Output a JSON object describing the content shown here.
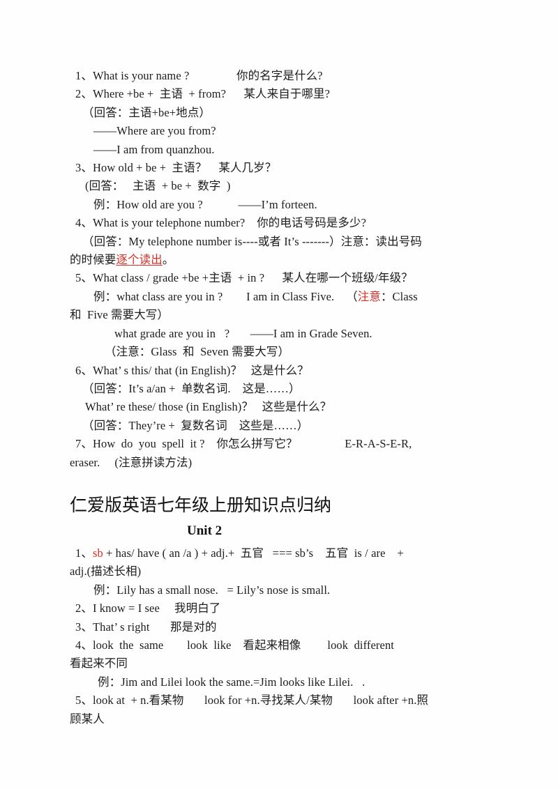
{
  "document": {
    "type": "scanned-study-notes",
    "language": "zh-CN / en",
    "text_color": "#1c1c1c",
    "accent_color": "#d93025",
    "background": "#ffffff"
  },
  "section_one": {
    "lines": [
      {
        "id": "l1",
        "indent": "ind0",
        "text": "1、What is your name ?                你的名字是什么?"
      },
      {
        "id": "l2",
        "indent": "ind0",
        "text": "2、Where +be +  主语  + from?      某人来自于哪里?"
      },
      {
        "id": "l3",
        "indent": "ind1",
        "text": "（回答：主语+be+地点）"
      },
      {
        "id": "l4",
        "indent": "ind3",
        "text": "——Where are you from?"
      },
      {
        "id": "l5",
        "indent": "ind3",
        "text": "——I am from quanzhou."
      },
      {
        "id": "l6",
        "indent": "ind0",
        "text": "3、How old + be +  主语？    某人几岁？"
      },
      {
        "id": "l7",
        "indent": "ind2",
        "text": "(回答：   主语  + be +  数字  )"
      },
      {
        "id": "l8",
        "indent": "ind3",
        "text": "例：How old are you ?            ——I’m forteen."
      },
      {
        "id": "l9",
        "indent": "ind0",
        "text": "4、What is your telephone number?    你的电话号码是多少?"
      },
      {
        "id": "l10",
        "indent": "ind1",
        "text": "（回答：My telephone number is----或者 It’s -------）注意：读出号码"
      }
    ],
    "line_11": {
      "indent": "neg",
      "prefix": "的时候要",
      "highlight": "逐个读出",
      "suffix": "。"
    },
    "lines_b": [
      {
        "id": "l12",
        "indent": "ind0",
        "text": "5、What class / grade +be +主语  + in ?      某人在哪一个班级/年级？"
      },
      {
        "id": "l13",
        "indent": "ind3",
        "text": "例：what class are you in ?        I am in Class Five.    "
      }
    ],
    "line_13_tail": {
      "open": "（",
      "highlight": "注意",
      "rest": "：Class"
    },
    "lines_c": [
      {
        "id": "l14",
        "indent": "neg",
        "text": "和  Five 需要大写）"
      },
      {
        "id": "l15",
        "indent": "ind6",
        "text": "what grade are you in   ?       ——I am in Grade Seven."
      },
      {
        "id": "l16",
        "indent": "ind5",
        "text": "（注意：Glass  和  Seven 需要大写）"
      },
      {
        "id": "l17",
        "indent": "ind0",
        "text": "6、What’ s this/ that (in English)？   这是什么？"
      },
      {
        "id": "l18",
        "indent": "ind1",
        "text": "（回答：It’s a/an +  单数名词.    这是……）"
      },
      {
        "id": "l19",
        "indent": "ind2",
        "text": "What’ re these/ those (in English)？   这些是什么？"
      },
      {
        "id": "l20",
        "indent": "ind1",
        "text": "（回答：They’re +  复数名词    这些是……）"
      },
      {
        "id": "l21",
        "indent": "ind0",
        "text": "7、How  do  you  spell  it ?    你怎么拼写它？                E-R-A-S-E-R,"
      },
      {
        "id": "l22",
        "indent": "neg",
        "text": "eraser.     (注意拼读方法)"
      }
    ]
  },
  "heading": {
    "main_title": "仁爱版英语七年级上册知识点归纳",
    "unit_label": "Unit 2"
  },
  "section_two": {
    "line_1": {
      "indent": "ind0",
      "prefix": "1、",
      "highlight": "sb",
      "suffix": " + has/ have ( an /a ) + adj.+  五官   === sb’s    五官  is / are    +"
    },
    "lines": [
      {
        "id": "u1",
        "indent": "neg",
        "text": "adj.(描述长相)"
      },
      {
        "id": "u2",
        "indent": "ind3",
        "text": "例：Lily has a small nose.   = Lily’s nose is small."
      },
      {
        "id": "u3",
        "indent": "ind0",
        "text": "2、I know = I see     我明白了"
      },
      {
        "id": "u4",
        "indent": "ind0",
        "text": "3、That’ s right       那是对的"
      },
      {
        "id": "u5",
        "indent": "ind0",
        "text": "4、look  the  same        look  like    看起来相像         look  different"
      },
      {
        "id": "u6",
        "indent": "neg",
        "text": "看起来不同"
      },
      {
        "id": "u7",
        "indent": "ind4",
        "text": "例：Jim and Lilei look the same.=Jim looks like Lilei.   ."
      },
      {
        "id": "u8",
        "indent": "ind0",
        "text": "5、look at  + n.看某物       look for +n.寻找某人/某物       look after +n.照"
      },
      {
        "id": "u9",
        "indent": "neg",
        "text": "顾某人"
      }
    ]
  }
}
